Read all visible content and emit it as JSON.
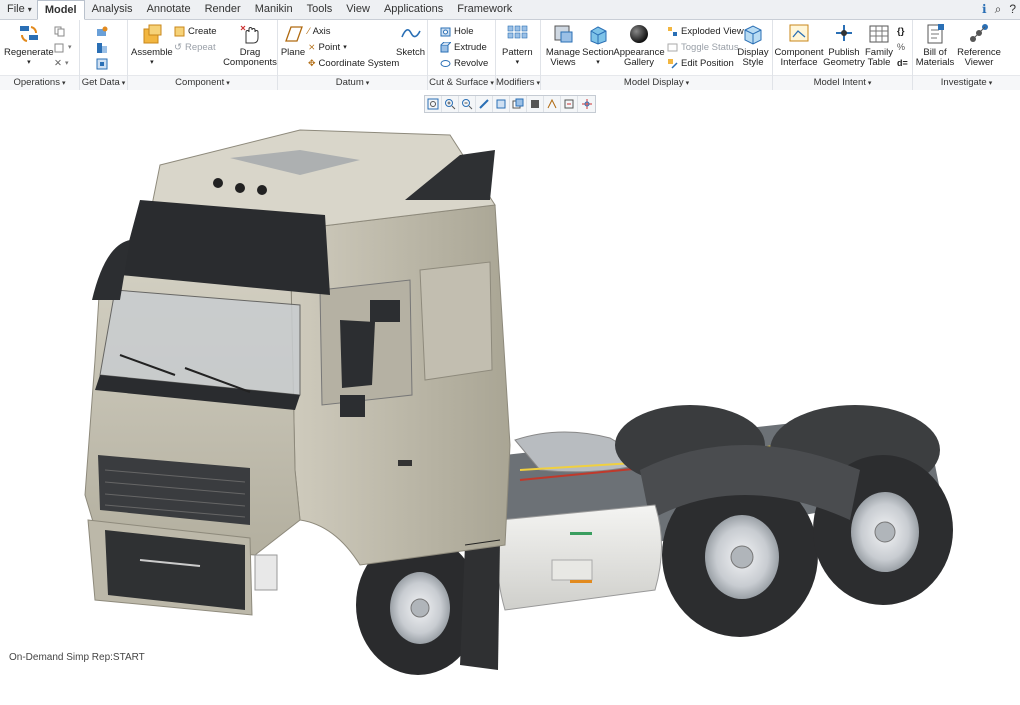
{
  "tabs": [
    {
      "label": "File",
      "caret": "▾"
    },
    {
      "label": "Model"
    },
    {
      "label": "Analysis"
    },
    {
      "label": "Annotate"
    },
    {
      "label": "Render"
    },
    {
      "label": "Manikin"
    },
    {
      "label": "Tools"
    },
    {
      "label": "View"
    },
    {
      "label": "Applications"
    },
    {
      "label": "Framework"
    }
  ],
  "groups": {
    "operations": {
      "label": "Operations",
      "regenerate": "Regenerate"
    },
    "get_data": {
      "label": "Get Data"
    },
    "component": {
      "label": "Component",
      "assemble": "Assemble",
      "create": "Create",
      "repeat": "Repeat",
      "drag": "Drag Components"
    },
    "datum": {
      "label": "Datum",
      "plane": "Plane",
      "axis": "Axis",
      "point": "Point",
      "csys": "Coordinate System",
      "sketch": "Sketch"
    },
    "cut_surface": {
      "label": "Cut & Surface",
      "hole": "Hole",
      "extrude": "Extrude",
      "revolve": "Revolve"
    },
    "modifiers": {
      "label": "Modifiers",
      "pattern": "Pattern"
    },
    "model_display": {
      "label": "Model Display",
      "manage_views": "Manage Views",
      "section": "Section",
      "appearance": "Appearance Gallery",
      "exploded": "Exploded View",
      "toggle_status": "Toggle Status",
      "edit_position": "Edit Position",
      "display_style": "Display Style"
    },
    "model_intent": {
      "label": "Model Intent",
      "component_interface": "Component Interface",
      "publish_geometry": "Publish Geometry",
      "family_table": "Family Table"
    },
    "investigate": {
      "label": "Investigate",
      "bom": "Bill of Materials",
      "reference_viewer": "Reference Viewer"
    }
  },
  "status_text": "On-Demand Simp Rep:START",
  "colors": {
    "accent": "#2a6fb5",
    "ribbon_bg": "#ffffff",
    "tabbar_bg": "#eef0f3"
  }
}
